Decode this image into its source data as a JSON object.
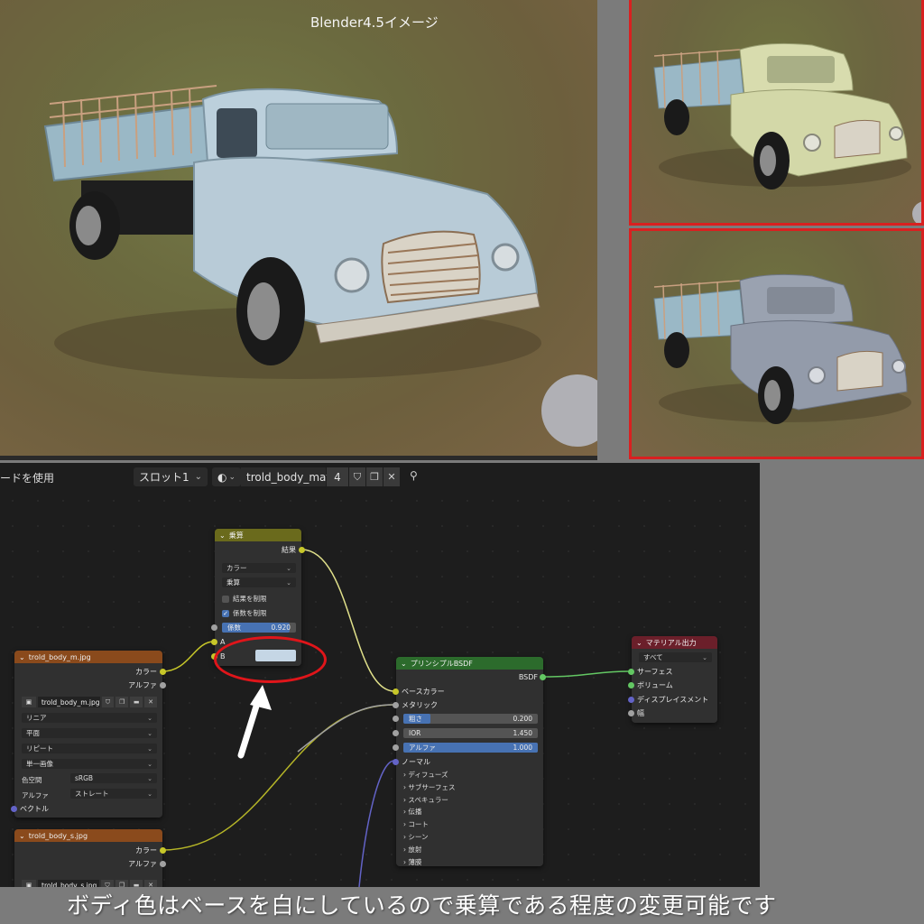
{
  "viewport_main": {
    "caption": "Blender4.5イメージ"
  },
  "editor_header": {
    "mode_label": "ードを使用",
    "slot": "スロット1",
    "material_name": "trold_body_mat",
    "users": "4"
  },
  "nodes": {
    "multiply": {
      "title": "乗算",
      "output_result": "結果",
      "type_select": "カラー",
      "blend_select": "乗算",
      "clamp_result": "結果を制限",
      "clamp_factor": "係数を制限",
      "factor_label": "係数",
      "factor_value": "0.920",
      "factor": 0.92,
      "input_a": "A",
      "input_b": "B",
      "b_color": "#c5d6e5",
      "header_color": "#6a6a1c"
    },
    "image_m": {
      "title": "trold_body_m.jpg",
      "out_color": "カラー",
      "out_alpha": "アルファ",
      "image_name": "trold_body_m.jpg",
      "interpolation": "リニア",
      "projection": "平面",
      "extension": "リピート",
      "source": "単一画像",
      "colorspace_label": "色空間",
      "colorspace": "sRGB",
      "alpha_label": "アルファ",
      "alpha_mode": "ストレート",
      "vector": "ベクトル",
      "header_color": "#8a4a1c"
    },
    "image_s": {
      "title": "trold_body_s.jpg",
      "out_color": "カラー",
      "out_alpha": "アルファ",
      "image_name": "trold_body_s.jpg",
      "header_color": "#8a4a1c"
    },
    "bsdf": {
      "title": "プリンシプルBSDF",
      "output": "BSDF",
      "base_color": "ベースカラー",
      "metallic": "メタリック",
      "roughness_label": "粗さ",
      "roughness_value": "0.200",
      "roughness": 0.2,
      "ior_label": "IOR",
      "ior_value": "1.450",
      "alpha_label": "アルファ",
      "alpha_value": "1.000",
      "alpha": 1.0,
      "normal": "ノーマル",
      "panels": [
        "ディフューズ",
        "サブサーフェス",
        "スペキュラー",
        "伝播",
        "コート",
        "シーン",
        "放射",
        "薄膜"
      ],
      "header_color": "#2c6b2c"
    },
    "output": {
      "title": "マテリアル出力",
      "target": "すべて",
      "surface": "サーフェス",
      "volume": "ボリューム",
      "displacement": "ディスプレイスメント",
      "thickness": "幅",
      "header_color": "#6b1f2a"
    }
  },
  "caption": "ボディ色はベースを白にしているので乗算である程度の変更可能です",
  "colors": {
    "highlight": "#e0151a",
    "wire_color": "#c7c729",
    "wire_shader": "#63c763",
    "wire_grey": "#a1a1a1",
    "wire_vector": "#6363c7"
  }
}
